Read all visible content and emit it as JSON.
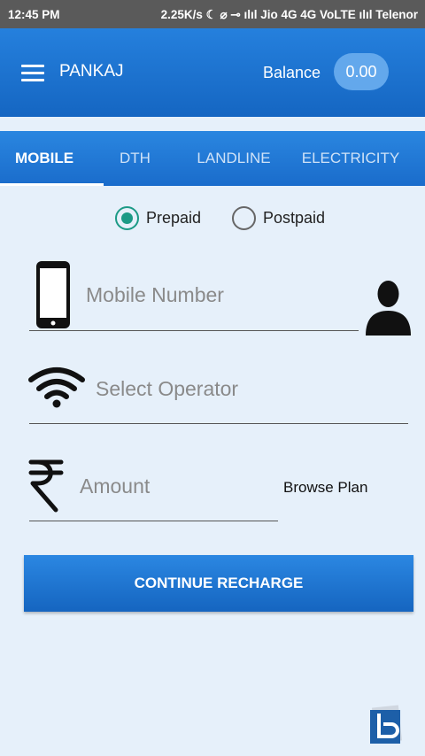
{
  "status_bar": {
    "time": "12:45 PM",
    "right_text": "2.25K/s ☾ ⌀ ⊸ ılıl Jio 4G 4G VoLTE ılıl Telenor"
  },
  "header": {
    "user_name": "PANKAJ",
    "balance_label": "Balance",
    "balance_value": "0.00"
  },
  "tabs": [
    {
      "label": "MOBILE",
      "active": true
    },
    {
      "label": "DTH",
      "active": false
    },
    {
      "label": "LANDLINE",
      "active": false
    },
    {
      "label": "ELECTRICITY",
      "active": false
    }
  ],
  "plan_type": {
    "options": [
      "Prepaid",
      "Postpaid"
    ],
    "selected": "Prepaid"
  },
  "form": {
    "mobile_placeholder": "Mobile Number",
    "operator_placeholder": "Select Operator",
    "amount_placeholder": "Amount",
    "browse_plan_label": "Browse Plan",
    "continue_label": "CONTINUE RECHARGE"
  },
  "colors": {
    "primary": "#1a6ccb",
    "accent": "#1c9a86",
    "background": "#e6f0fa"
  },
  "icons": [
    "menu-icon",
    "smartphone-icon",
    "contact-person-icon",
    "wifi-signal-icon",
    "rupee-icon",
    "brand-logo-icon"
  ]
}
